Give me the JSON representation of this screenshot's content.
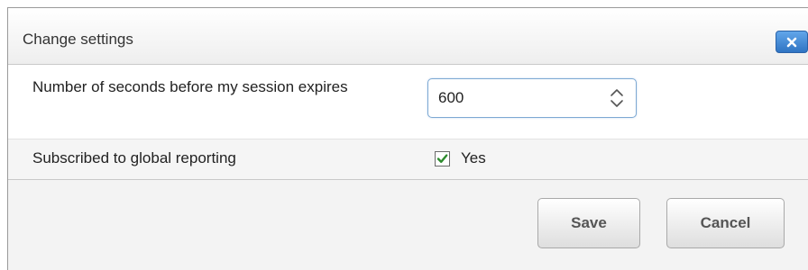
{
  "dialog": {
    "title": "Change settings",
    "close_icon": "close-icon"
  },
  "settings": {
    "session_timeout": {
      "label": "Number of seconds before my session expires",
      "value": "600",
      "icon": "stepper-arrows-icon"
    },
    "global_reporting": {
      "label": "Subscribed to global reporting",
      "checked": true,
      "checkbox_label": "Yes",
      "icon": "checkmark-icon"
    }
  },
  "buttons": {
    "save": "Save",
    "cancel": "Cancel"
  },
  "colors": {
    "close_button": "#3b82d0",
    "checkmark": "#2e8b2e",
    "input_focus_border": "#7ea9d3"
  }
}
